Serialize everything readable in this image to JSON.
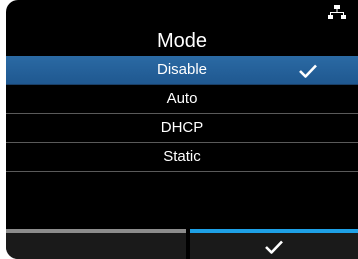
{
  "screen": {
    "title": "Mode",
    "status_icon": "network-icon"
  },
  "options": [
    {
      "label": "Disable",
      "selected": true
    },
    {
      "label": "Auto",
      "selected": false
    },
    {
      "label": "DHCP",
      "selected": false
    },
    {
      "label": "Static",
      "selected": false
    }
  ],
  "softkeys": {
    "left": {
      "icon": "",
      "enabled": false
    },
    "right": {
      "icon": "checkmark-icon",
      "enabled": true
    }
  },
  "colors": {
    "background": "#000000",
    "selected_row": "#2b6aa4",
    "softkey_active_accent": "#1ea0e6",
    "softkey_inactive_accent": "#8c8c8c",
    "text": "#ffffff"
  }
}
